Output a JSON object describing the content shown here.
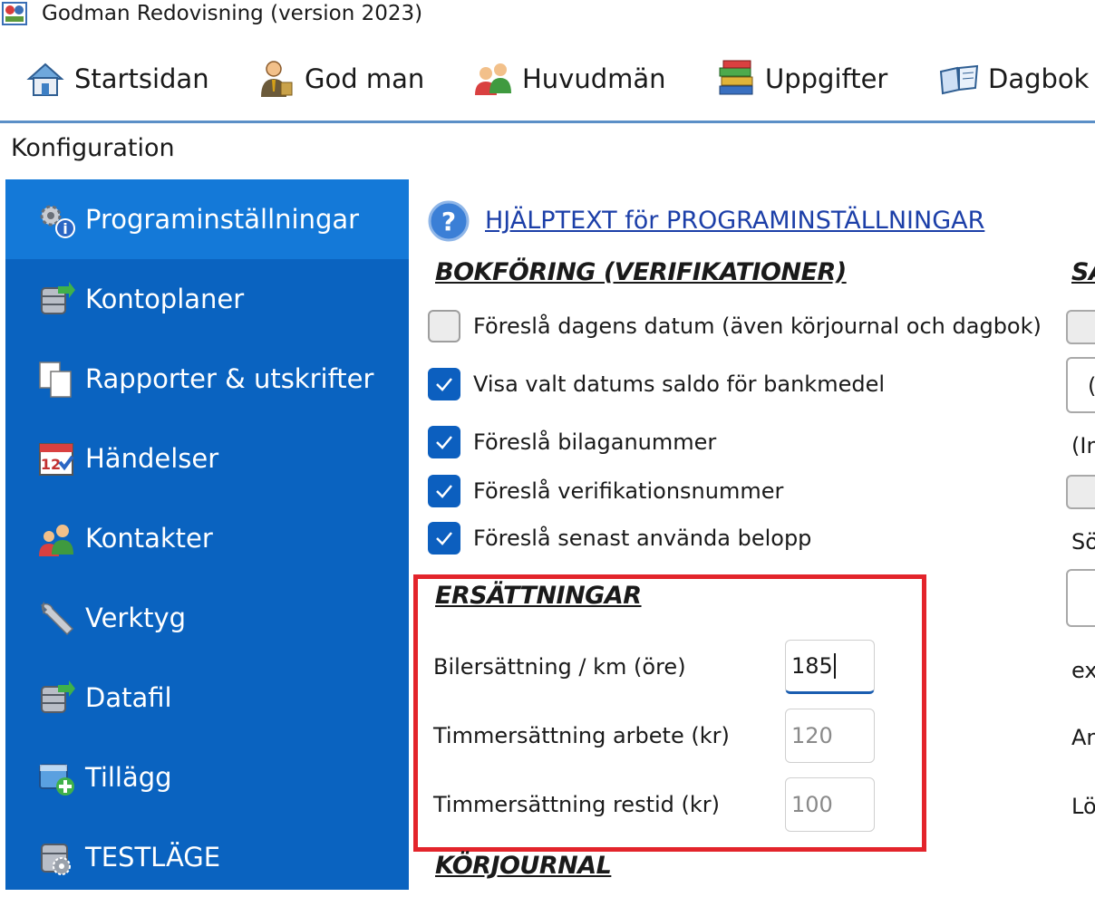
{
  "window": {
    "title": "Godman Redovisning (version 2023)"
  },
  "toolbar": {
    "items": [
      {
        "label": "Startsidan",
        "icon": "home-icon"
      },
      {
        "label": "God man",
        "icon": "person-tie-icon"
      },
      {
        "label": "Huvudmän",
        "icon": "people-icon"
      },
      {
        "label": "Uppgifter",
        "icon": "books-icon"
      },
      {
        "label": "Dagbok",
        "icon": "open-book-icon"
      }
    ]
  },
  "page": {
    "title": "Konfiguration"
  },
  "sidebar": {
    "items": [
      {
        "label": "Programinställningar",
        "icon": "gears-info-icon",
        "active": true
      },
      {
        "label": "Kontoplaner",
        "icon": "database-arrow-icon"
      },
      {
        "label": "Rapporter & utskrifter",
        "icon": "documents-icon"
      },
      {
        "label": "Händelser",
        "icon": "calendar-icon"
      },
      {
        "label": "Kontakter",
        "icon": "contacts-icon"
      },
      {
        "label": "Verktyg",
        "icon": "wrench-icon"
      },
      {
        "label": "Datafil",
        "icon": "database-arrow-icon"
      },
      {
        "label": "Tillägg",
        "icon": "addon-icon"
      },
      {
        "label": "TESTLÄGE",
        "icon": "database-gear-icon"
      }
    ]
  },
  "help": {
    "link_text": "HJÄLPTEXT  för  PROGRAMINSTÄLLNINGAR"
  },
  "bokforing": {
    "title": "BOKFÖRING (VERIFIKATIONER)",
    "options": [
      {
        "label": "Föreslå dagens datum (även körjournal och dagbok)",
        "checked": false
      },
      {
        "label": "Visa valt datums saldo för bankmedel",
        "checked": true
      },
      {
        "label": "Föreslå bilaganummer",
        "checked": true
      },
      {
        "label": "Föreslå verifikationsnummer",
        "checked": true
      },
      {
        "label": "Föreslå senast använda belopp",
        "checked": true
      }
    ]
  },
  "ersattningar": {
    "title": "ERSÄTTNINGAR",
    "fields": [
      {
        "label": "Bilersättning / km (öre)",
        "value": "185"
      },
      {
        "label": "Timmersättning arbete (kr)",
        "value": "120"
      },
      {
        "label": "Timmersättning restid (kr)",
        "value": "100"
      }
    ]
  },
  "korjournal": {
    "title": "KÖRJOURNAL"
  },
  "right_column": {
    "title_partial": "SA",
    "select_partial": "(",
    "note_partial": "(In",
    "search_label_partial": "Sö",
    "text1_partial": "ex",
    "text2_partial": "An",
    "text3_partial": "Lö"
  },
  "colors": {
    "sidebar_bg": "#0a63c0",
    "sidebar_active": "#1479d8",
    "checkbox_checked": "#0c5fbf",
    "highlight_border": "#e3242b",
    "link": "#1c3fa8"
  }
}
